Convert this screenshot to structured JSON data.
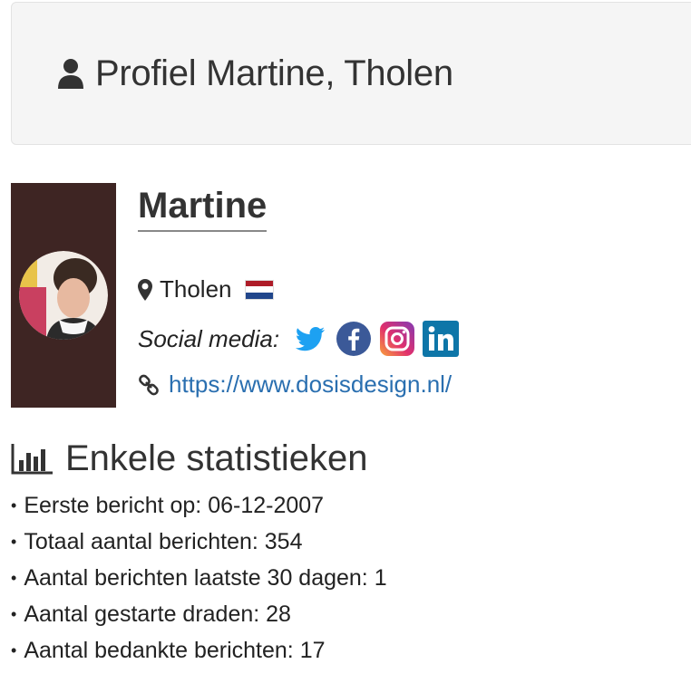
{
  "header": {
    "icon": "user-icon",
    "title": "Profiel Martine, Tholen"
  },
  "profile": {
    "username": "Martine",
    "location": "Tholen",
    "flag": "netherlands-flag",
    "social_label": "Social media:",
    "social_icons": [
      "twitter-icon",
      "facebook-icon",
      "instagram-icon",
      "linkedin-icon"
    ],
    "website": "https://www.dosisdesign.nl/"
  },
  "stats": {
    "title": "Enkele statistieken",
    "items": [
      "Eerste bericht op: 06-12-2007",
      "Totaal aantal berichten: 354",
      "Aantal berichten laatste 30 dagen: 1",
      "Aantal gestarte draden: 28",
      "Aantal bedankte berichten: 17"
    ]
  },
  "colors": {
    "link": "#2a6fb0",
    "avatar_bg": "#3e2523",
    "twitter": "#1da1f2",
    "facebook": "#3b5998",
    "linkedin": "#0e76a8"
  }
}
